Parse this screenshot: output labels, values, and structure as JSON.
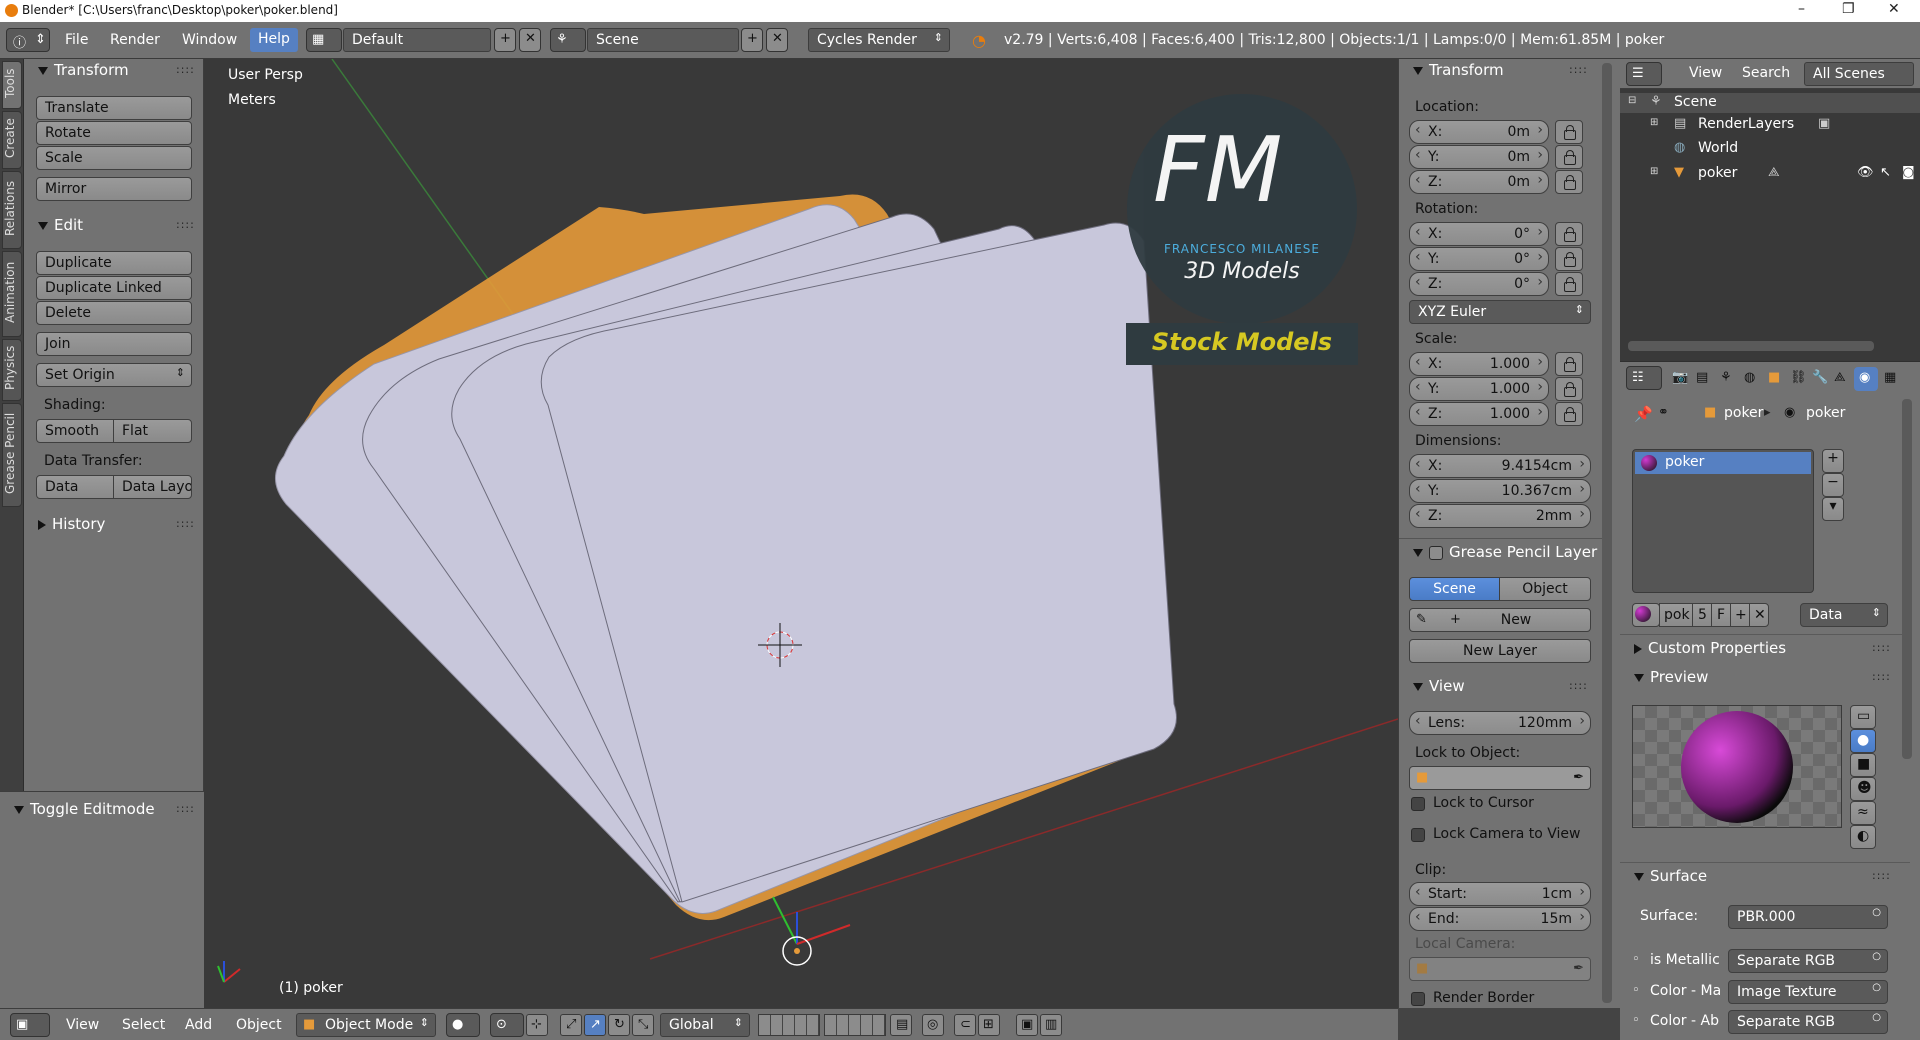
{
  "window": {
    "title": "Blender* [C:\\Users\\franc\\Desktop\\poker\\poker.blend]",
    "minimize": "–",
    "maximize": "❐",
    "close": "✕"
  },
  "info": {
    "menus": [
      "File",
      "Render",
      "Window",
      "Help"
    ],
    "screen_layout": "Default",
    "scene": "Scene",
    "engine": "Cycles Render",
    "stats": "v2.79 | Verts:6,408 | Faces:6,400 | Tris:12,800 | Objects:1/1 | Lamps:0/0 | Mem:61.85M | poker"
  },
  "tabs": [
    "Tools",
    "Create",
    "Relations",
    "Animation",
    "Physics",
    "Grease Pencil"
  ],
  "toolshelf": {
    "transform_title": "Transform",
    "translate": "Translate",
    "rotate": "Rotate",
    "scale": "Scale",
    "mirror": "Mirror",
    "edit_title": "Edit",
    "duplicate": "Duplicate",
    "duplicate_linked": "Duplicate Linked",
    "delete": "Delete",
    "join": "Join",
    "set_origin": "Set Origin",
    "shading_label": "Shading:",
    "smooth": "Smooth",
    "flat": "Flat",
    "data_transfer_label": "Data Transfer:",
    "data": "Data",
    "data_layout": "Data Layo",
    "history_title": "History",
    "toggle_editmode": "Toggle Editmode"
  },
  "viewport": {
    "view_name": "User Persp",
    "units": "Meters",
    "object_label": "(1) poker",
    "watermark_letters": "FM",
    "watermark_name": "FRANCESCO MILANESE",
    "watermark_sub": "3D Models",
    "watermark_stock": "Stock Models"
  },
  "npanel": {
    "transform_title": "Transform",
    "location_label": "Location:",
    "location": [
      {
        "k": "X:",
        "v": "0m"
      },
      {
        "k": "Y:",
        "v": "0m"
      },
      {
        "k": "Z:",
        "v": "0m"
      }
    ],
    "rotation_label": "Rotation:",
    "rotation": [
      {
        "k": "X:",
        "v": "0°"
      },
      {
        "k": "Y:",
        "v": "0°"
      },
      {
        "k": "Z:",
        "v": "0°"
      }
    ],
    "rotation_mode": "XYZ Euler",
    "scale_label": "Scale:",
    "scale": [
      {
        "k": "X:",
        "v": "1.000"
      },
      {
        "k": "Y:",
        "v": "1.000"
      },
      {
        "k": "Z:",
        "v": "1.000"
      }
    ],
    "dimensions_label": "Dimensions:",
    "dimensions": [
      {
        "k": "X:",
        "v": "9.4154cm"
      },
      {
        "k": "Y:",
        "v": "10.367cm"
      },
      {
        "k": "Z:",
        "v": "2mm"
      }
    ],
    "grease_title": "Grease Pencil Layer",
    "scene_btn": "Scene",
    "object_btn": "Object",
    "new_btn": "New",
    "new_layer_btn": "New Layer",
    "view_title": "View",
    "lens_k": "Lens:",
    "lens_v": "120mm",
    "lock_to_object": "Lock to Object:",
    "lock_to_cursor": "Lock to Cursor",
    "lock_camera": "Lock Camera to View",
    "clip_label": "Clip:",
    "clip_start_k": "Start:",
    "clip_start_v": "1cm",
    "clip_end_k": "End:",
    "clip_end_v": "15m",
    "local_camera": "Local Camera:",
    "render_border": "Render Border"
  },
  "outliner": {
    "view": "View",
    "search": "Search",
    "filter": "All Scenes",
    "scene": "Scene",
    "renderlayers": "RenderLayers",
    "world": "World",
    "poker": "poker"
  },
  "properties": {
    "crumb_obj": "poker",
    "crumb_mat": "poker",
    "material_slot": "poker",
    "mat_name": "pok",
    "users": "5",
    "fake": "F",
    "link": "Data",
    "custom_props": "Custom Properties",
    "preview": "Preview",
    "surface_title": "Surface",
    "surface_label": "Surface:",
    "surface_value": "PBR.000",
    "inputs": [
      {
        "k": "is Metallic",
        "v": "Separate RGB"
      },
      {
        "k": "Color - Ma",
        "v": "Image Texture"
      },
      {
        "k": "Color - Ab",
        "v": "Separate RGB"
      }
    ]
  },
  "bottombar": {
    "view": "View",
    "select": "Select",
    "add": "Add",
    "object": "Object",
    "mode": "Object Mode",
    "orientation": "Global"
  },
  "colors": {
    "panel": "#727272",
    "viewport": "#393939",
    "selected": "#5680c2",
    "card_face": "#c8c7db",
    "outline": "#e59a3a"
  }
}
